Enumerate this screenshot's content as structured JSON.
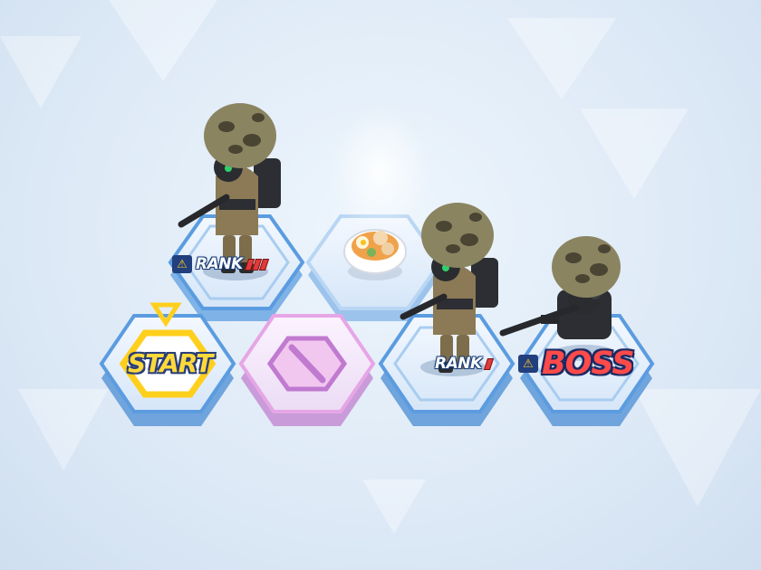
{
  "board": {
    "start_tile": {
      "label": "START"
    },
    "blocked_tile": {
      "icon": "blocked-icon"
    },
    "food_tile": {
      "icon": "food-bowl-icon"
    },
    "enemy_tiles": [
      {
        "tag": "RANK",
        "rank_pips": 3,
        "warning": true
      },
      {
        "tag": "RANK",
        "rank_pips": 1,
        "warning": false
      },
      {
        "tag": "BOSS",
        "rank_pips": 0,
        "warning": true
      }
    ]
  },
  "colors": {
    "tile_blue": "#5b9ce0",
    "tile_pink": "#e6a6e6",
    "start_yellow": "#ffd93a",
    "boss_red": "#ff4a4a",
    "rank_red": "#e23a3a"
  }
}
